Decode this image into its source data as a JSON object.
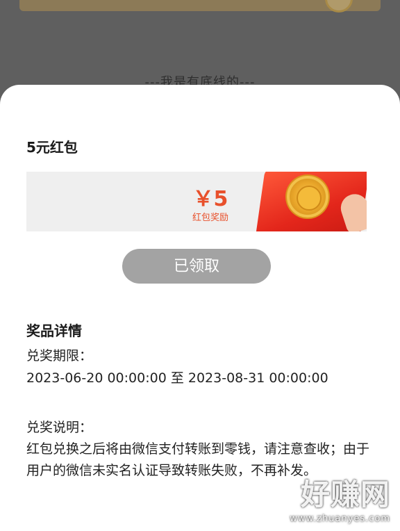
{
  "background": {
    "hint_text": "---我是有底线的---"
  },
  "sheet": {
    "title": "5元红包",
    "prize": {
      "amount": "￥5",
      "caption": "红包奖励"
    },
    "claim_button_label": "已领取",
    "details_title": "奖品详情",
    "period_label": "兑奖期限：",
    "period_value": "2023-06-20 00:00:00 至 2023-08-31 00:00:00",
    "description_label": "兑奖说明：",
    "description_value": "红包兑换之后将由微信支付转账到零钱，请注意查收；由于用户的微信未实名认证导致转账失败，不再补发。"
  },
  "watermark": {
    "brand": "好赚网",
    "domain": "www.zhuanyes.com"
  },
  "colors": {
    "accent_red": "#e8502b",
    "button_gray": "#a3a3a3",
    "overlay": "#5f5f5f"
  }
}
